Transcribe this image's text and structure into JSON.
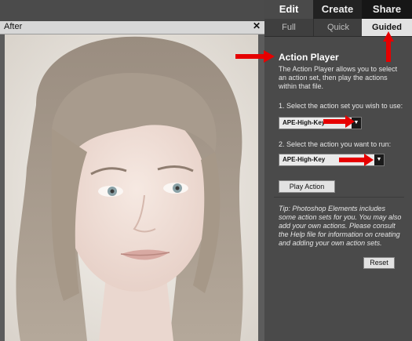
{
  "canvas": {
    "title": "After",
    "close_label": "✕"
  },
  "tabs": [
    {
      "label": "Edit"
    },
    {
      "label": "Create"
    },
    {
      "label": "Share"
    }
  ],
  "subtabs": [
    {
      "label": "Full"
    },
    {
      "label": "Quick"
    },
    {
      "label": "Guided"
    }
  ],
  "panel": {
    "title": "Action Player",
    "description": "The Action Player allows you to select an action set, then play the actions within that file.",
    "step1_label": "1. Select the action set you wish to use:",
    "step1_value": "APE-High-Key",
    "step2_label": "2. Select the action you want to run:",
    "step2_value": "APE-High-Key",
    "play_label": "Play Action",
    "tip": "Tip: Photoshop Elements includes some action sets for you. You may also add your own actions. Please consult the Help file for information on creating and adding your own action sets.",
    "reset_label": "Reset"
  },
  "colors": {
    "annotation_arrow": "#e60000",
    "panel_bg": "#4a4a4a",
    "tab_bar": "#111111"
  },
  "icons": {
    "dropdown": "chevron-down-icon",
    "close": "close-icon",
    "annotation": "red-arrow-icon"
  }
}
